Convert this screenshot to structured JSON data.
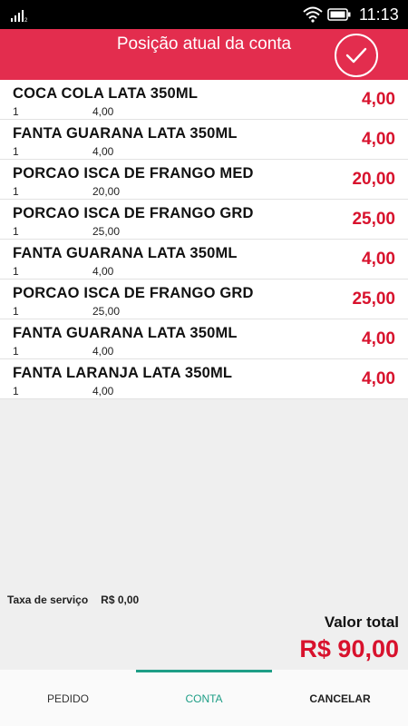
{
  "status_bar": {
    "time": "11:13",
    "signal_icon": "signal-icon",
    "wifi_icon": "wifi-icon",
    "battery_icon": "battery-icon"
  },
  "header": {
    "title": "Posição atual da conta",
    "confirm_icon": "check-icon",
    "color": "#e32d4e"
  },
  "items": [
    {
      "name": "COCA COLA LATA 350ML",
      "qty": "1",
      "unit_price": "4,00",
      "total": "4,00"
    },
    {
      "name": "FANTA GUARANA LATA 350ML",
      "qty": "1",
      "unit_price": "4,00",
      "total": "4,00"
    },
    {
      "name": "PORCAO ISCA DE FRANGO MED",
      "qty": "1",
      "unit_price": "20,00",
      "total": "20,00"
    },
    {
      "name": "PORCAO ISCA DE FRANGO GRD",
      "qty": "1",
      "unit_price": "25,00",
      "total": "25,00"
    },
    {
      "name": "FANTA GUARANA LATA 350ML",
      "qty": "1",
      "unit_price": "4,00",
      "total": "4,00"
    },
    {
      "name": "PORCAO ISCA DE FRANGO GRD",
      "qty": "1",
      "unit_price": "25,00",
      "total": "25,00"
    },
    {
      "name": "FANTA GUARANA LATA 350ML",
      "qty": "1",
      "unit_price": "4,00",
      "total": "4,00"
    },
    {
      "name": "FANTA LARANJA LATA 350ML",
      "qty": "1",
      "unit_price": "4,00",
      "total": "4,00"
    }
  ],
  "summary": {
    "service_label": "Taxa de serviço",
    "service_value": "R$ 0,00",
    "total_label": "Valor total",
    "total_value": "R$ 90,00"
  },
  "nav": {
    "tabs": [
      {
        "label": "PEDIDO",
        "active": false
      },
      {
        "label": "CONTA",
        "active": true
      },
      {
        "label": "CANCELAR",
        "active": false
      }
    ]
  },
  "colors": {
    "accent": "#e32d4e",
    "price": "#d8122d",
    "active_tab": "#1e9e86"
  }
}
